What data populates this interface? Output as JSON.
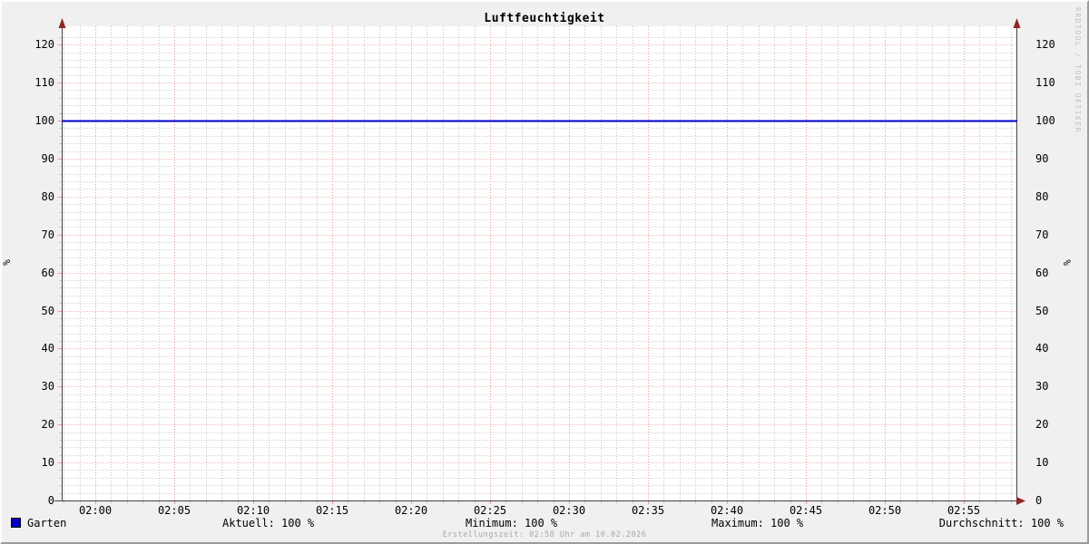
{
  "colors": {
    "background": "#f0f0f0",
    "canvas": "#ffffff",
    "grid_minor": "#c4c4c4",
    "grid_major": "#ee9e9e",
    "axis": "#444444",
    "arrow": "#8f2525",
    "series_line": "#0000c8",
    "text": "#000000",
    "footer_text": "#a8a8a8",
    "watermark_text": "#c2c2c2"
  },
  "chart_data": {
    "type": "line",
    "title": "Luftfeuchtigkeit",
    "ylabel_left": "%",
    "ylabel_right": "%",
    "ylim": [
      0,
      124
    ],
    "yticks": [
      0,
      10,
      20,
      30,
      40,
      50,
      60,
      70,
      80,
      90,
      100,
      110,
      120
    ],
    "y_minor_step": 2,
    "x_range_minutes": [
      -2.1,
      58.4
    ],
    "x_minor_step_min": 1,
    "x_major_step_min": 5,
    "xticks": [
      {
        "label": "02:00",
        "minute": 0
      },
      {
        "label": "02:05",
        "minute": 5
      },
      {
        "label": "02:10",
        "minute": 10
      },
      {
        "label": "02:15",
        "minute": 15
      },
      {
        "label": "02:20",
        "minute": 20
      },
      {
        "label": "02:25",
        "minute": 25
      },
      {
        "label": "02:30",
        "minute": 30
      },
      {
        "label": "02:35",
        "minute": 35
      },
      {
        "label": "02:40",
        "minute": 40
      },
      {
        "label": "02:45",
        "minute": 45
      },
      {
        "label": "02:50",
        "minute": 50
      },
      {
        "label": "02:55",
        "minute": 55
      }
    ],
    "series": [
      {
        "name": "Garten",
        "color": "#0000c8",
        "points": [
          {
            "x_min": -2.1,
            "y": 100
          },
          {
            "x_min": 58.4,
            "y": 100
          }
        ]
      }
    ],
    "legend_stats": [
      {
        "label": "Aktuell",
        "value": 100,
        "unit": "%",
        "text": "Aktuell: 100 %"
      },
      {
        "label": "Minimum",
        "value": 100,
        "unit": "%",
        "text": "Minimum: 100 %"
      },
      {
        "label": "Maximum",
        "value": 100,
        "unit": "%",
        "text": "Maximum: 100 %"
      },
      {
        "label": "Durchschnitt",
        "value": 100,
        "unit": "%",
        "text": "Durchschnitt: 100 %"
      }
    ],
    "footer": "Erstellungszeit: 02:58 Uhr am 10.02.2026",
    "watermark": "RRDTOOL / TOBI OETIKER"
  }
}
